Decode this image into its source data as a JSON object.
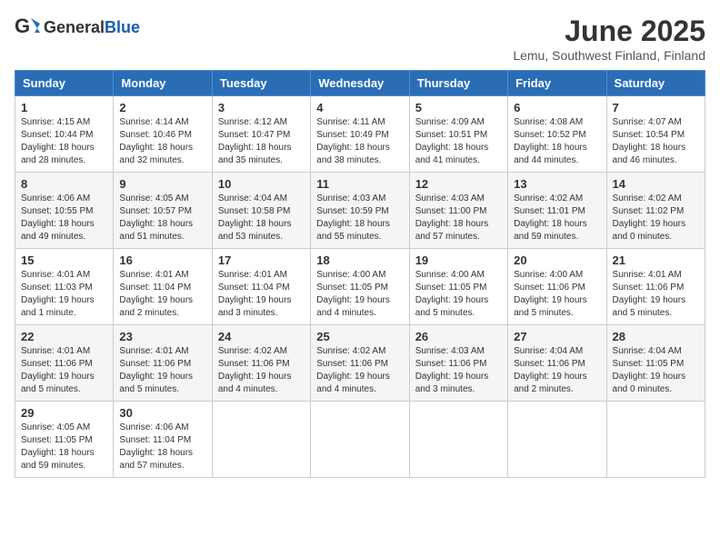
{
  "header": {
    "logo_general": "General",
    "logo_blue": "Blue",
    "month": "June 2025",
    "location": "Lemu, Southwest Finland, Finland"
  },
  "weekdays": [
    "Sunday",
    "Monday",
    "Tuesday",
    "Wednesday",
    "Thursday",
    "Friday",
    "Saturday"
  ],
  "weeks": [
    [
      {
        "day": 1,
        "sunrise": "4:15 AM",
        "sunset": "10:44 PM",
        "daylight": "18 hours and 28 minutes."
      },
      {
        "day": 2,
        "sunrise": "4:14 AM",
        "sunset": "10:46 PM",
        "daylight": "18 hours and 32 minutes."
      },
      {
        "day": 3,
        "sunrise": "4:12 AM",
        "sunset": "10:47 PM",
        "daylight": "18 hours and 35 minutes."
      },
      {
        "day": 4,
        "sunrise": "4:11 AM",
        "sunset": "10:49 PM",
        "daylight": "18 hours and 38 minutes."
      },
      {
        "day": 5,
        "sunrise": "4:09 AM",
        "sunset": "10:51 PM",
        "daylight": "18 hours and 41 minutes."
      },
      {
        "day": 6,
        "sunrise": "4:08 AM",
        "sunset": "10:52 PM",
        "daylight": "18 hours and 44 minutes."
      },
      {
        "day": 7,
        "sunrise": "4:07 AM",
        "sunset": "10:54 PM",
        "daylight": "18 hours and 46 minutes."
      }
    ],
    [
      {
        "day": 8,
        "sunrise": "4:06 AM",
        "sunset": "10:55 PM",
        "daylight": "18 hours and 49 minutes."
      },
      {
        "day": 9,
        "sunrise": "4:05 AM",
        "sunset": "10:57 PM",
        "daylight": "18 hours and 51 minutes."
      },
      {
        "day": 10,
        "sunrise": "4:04 AM",
        "sunset": "10:58 PM",
        "daylight": "18 hours and 53 minutes."
      },
      {
        "day": 11,
        "sunrise": "4:03 AM",
        "sunset": "10:59 PM",
        "daylight": "18 hours and 55 minutes."
      },
      {
        "day": 12,
        "sunrise": "4:03 AM",
        "sunset": "11:00 PM",
        "daylight": "18 hours and 57 minutes."
      },
      {
        "day": 13,
        "sunrise": "4:02 AM",
        "sunset": "11:01 PM",
        "daylight": "18 hours and 59 minutes."
      },
      {
        "day": 14,
        "sunrise": "4:02 AM",
        "sunset": "11:02 PM",
        "daylight": "19 hours and 0 minutes."
      }
    ],
    [
      {
        "day": 15,
        "sunrise": "4:01 AM",
        "sunset": "11:03 PM",
        "daylight": "19 hours and 1 minute."
      },
      {
        "day": 16,
        "sunrise": "4:01 AM",
        "sunset": "11:04 PM",
        "daylight": "19 hours and 2 minutes."
      },
      {
        "day": 17,
        "sunrise": "4:01 AM",
        "sunset": "11:04 PM",
        "daylight": "19 hours and 3 minutes."
      },
      {
        "day": 18,
        "sunrise": "4:00 AM",
        "sunset": "11:05 PM",
        "daylight": "19 hours and 4 minutes."
      },
      {
        "day": 19,
        "sunrise": "4:00 AM",
        "sunset": "11:05 PM",
        "daylight": "19 hours and 5 minutes."
      },
      {
        "day": 20,
        "sunrise": "4:00 AM",
        "sunset": "11:06 PM",
        "daylight": "19 hours and 5 minutes."
      },
      {
        "day": 21,
        "sunrise": "4:01 AM",
        "sunset": "11:06 PM",
        "daylight": "19 hours and 5 minutes."
      }
    ],
    [
      {
        "day": 22,
        "sunrise": "4:01 AM",
        "sunset": "11:06 PM",
        "daylight": "19 hours and 5 minutes."
      },
      {
        "day": 23,
        "sunrise": "4:01 AM",
        "sunset": "11:06 PM",
        "daylight": "19 hours and 5 minutes."
      },
      {
        "day": 24,
        "sunrise": "4:02 AM",
        "sunset": "11:06 PM",
        "daylight": "19 hours and 4 minutes."
      },
      {
        "day": 25,
        "sunrise": "4:02 AM",
        "sunset": "11:06 PM",
        "daylight": "19 hours and 4 minutes."
      },
      {
        "day": 26,
        "sunrise": "4:03 AM",
        "sunset": "11:06 PM",
        "daylight": "19 hours and 3 minutes."
      },
      {
        "day": 27,
        "sunrise": "4:04 AM",
        "sunset": "11:06 PM",
        "daylight": "19 hours and 2 minutes."
      },
      {
        "day": 28,
        "sunrise": "4:04 AM",
        "sunset": "11:05 PM",
        "daylight": "19 hours and 0 minutes."
      }
    ],
    [
      {
        "day": 29,
        "sunrise": "4:05 AM",
        "sunset": "11:05 PM",
        "daylight": "18 hours and 59 minutes."
      },
      {
        "day": 30,
        "sunrise": "4:06 AM",
        "sunset": "11:04 PM",
        "daylight": "18 hours and 57 minutes."
      },
      null,
      null,
      null,
      null,
      null
    ]
  ]
}
